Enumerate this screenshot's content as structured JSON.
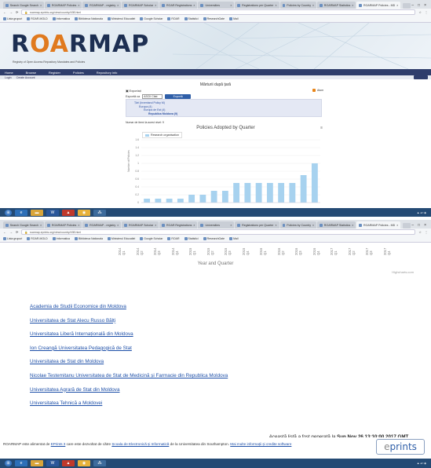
{
  "top": {
    "tabs": [
      "Search Google Search",
      "ROARMAP Policies",
      "ROARMAP - registry",
      "ROARMAP Scholar",
      "ROAR Registrations",
      "Universities",
      "Registrations per Quarter",
      "Policies by Country",
      "ROARMAP Statistics",
      "ROARMAP Policies - MD"
    ],
    "url": "roarmap.eprints.org/view/country/498.html",
    "bookmarks": [
      "Lista grupuri",
      "ROAR-MOLD",
      "Informatica",
      "Biblioteca Nationala",
      "Ministerul Educatiei",
      "Google Scholar",
      "ROAR",
      "Statistici",
      "ResearchGate",
      "Mail"
    ]
  },
  "site": {
    "logo_pre": "R",
    "logo_oa": "OA",
    "logo_post": "RMAP",
    "tagline": "Registry of Open Access Repository Mandates and Policies",
    "nav": [
      "Home",
      "Browse",
      "Register",
      "Policies",
      "Repository info"
    ],
    "subnav": [
      "Login",
      "Create Account"
    ]
  },
  "page": {
    "title": "Mărturii după țară",
    "export_label": "Exportați",
    "export_as": "Exportă ca",
    "export_format": "ASCII Citat",
    "export_button": "Exportă",
    "rss": "Atom",
    "tree": [
      "Țări (Inventarul Policy M)",
      "Europa (4)",
      "Europa de Est (4)",
      "Republica Moldova (9)"
    ],
    "count": "Numar de itemi la acest nivel: 9"
  },
  "chart_data": {
    "type": "bar",
    "title": "Policies Adopted by Quarter",
    "legend": "Research organisation",
    "ylabel": "Number of Policies",
    "xlabel": "Year and Quarter",
    "credit": "Highcharts.com",
    "ylim": [
      0,
      1.6
    ],
    "yticks": [
      "0",
      "0.2",
      "0.4",
      "0.6",
      "0.8",
      "1",
      "1.2",
      "1.4",
      "1.6"
    ],
    "categories": [
      "2014 Q1",
      "2014 Q2",
      "2014 Q3",
      "2014 Q4",
      "2015 Q1",
      "2015 Q2",
      "2015 Q3",
      "2015 Q4",
      "2016 Q1",
      "2016 Q2",
      "2016 Q3",
      "2016 Q4",
      "2017 Q1",
      "2017 Q2",
      "2017 Q3",
      "2017 Q4"
    ],
    "values": [
      0.1,
      0.1,
      0.1,
      0.1,
      0.2,
      0.2,
      0.3,
      0.3,
      0.5,
      0.5,
      0.5,
      0.5,
      0.5,
      0.5,
      0.7,
      1.0
    ]
  },
  "universities": [
    "Academia de Studii Economice din Moldova",
    "Universitatea de Stat Alecu Russo Bălți",
    "Universitatea Liberă Internațională din Moldova",
    "Ion Creangă Universitatea Pedagogică de Stat",
    "Universitatea de Stat din Moldova",
    "Nicolae Testemitanu Universitatea de Stat de Medicină și Farmacie din Republica Moldova",
    "Universitatea Agrară de Stat din Moldova",
    "Universitatea Tehnică a Moldovei"
  ],
  "generated": {
    "prefix": "Această listă a fost generată la ",
    "time": "Sun Nov 26 13:10:00 2017 GMT",
    "suffix": "."
  },
  "footer": {
    "text1": "ROARMAP este alimentat de ",
    "eprints_link": "EPrints 3",
    "text2": " care este dezvoltat de către ",
    "school_link": "Școala de Electronică și Informatică",
    "text3": " de la Universitatea din Southampton. ",
    "more_link": "Mai multe informații și credite software",
    "logo_e": "e",
    "logo_rest": "prints"
  },
  "colors": {
    "bar": "#a7d2ef",
    "nav": "#2f3d6b",
    "link": "#1d4fa8",
    "taskbar": "#244a74"
  }
}
